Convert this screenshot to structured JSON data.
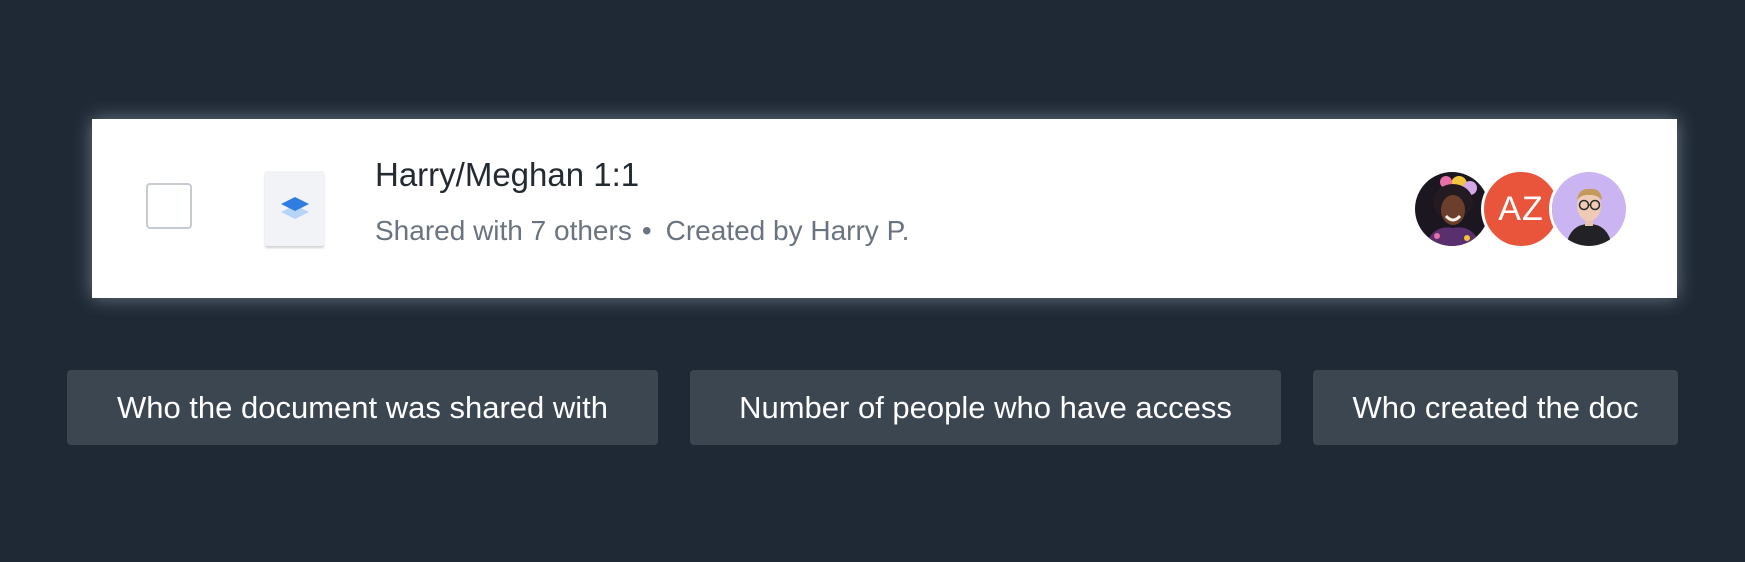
{
  "document": {
    "title": "Harry/Meghan 1:1",
    "shared_text": "Shared with 7 others",
    "separator": "•",
    "created_text": "Created by Harry P.",
    "icon": "layers-icon",
    "checked": false
  },
  "avatars": [
    {
      "type": "photo",
      "name": "avatar-photo-woman"
    },
    {
      "type": "initials",
      "initials": "AZ",
      "color": "#e9553b"
    },
    {
      "type": "photo",
      "name": "avatar-photo-man"
    }
  ],
  "labels": [
    "Who the document was shared with",
    "Number of people who have access",
    "Who created the doc"
  ],
  "colors": {
    "background": "#1e2935",
    "card": "#ffffff",
    "label_box": "#3b4651",
    "accent_blue": "#2f7de1"
  }
}
